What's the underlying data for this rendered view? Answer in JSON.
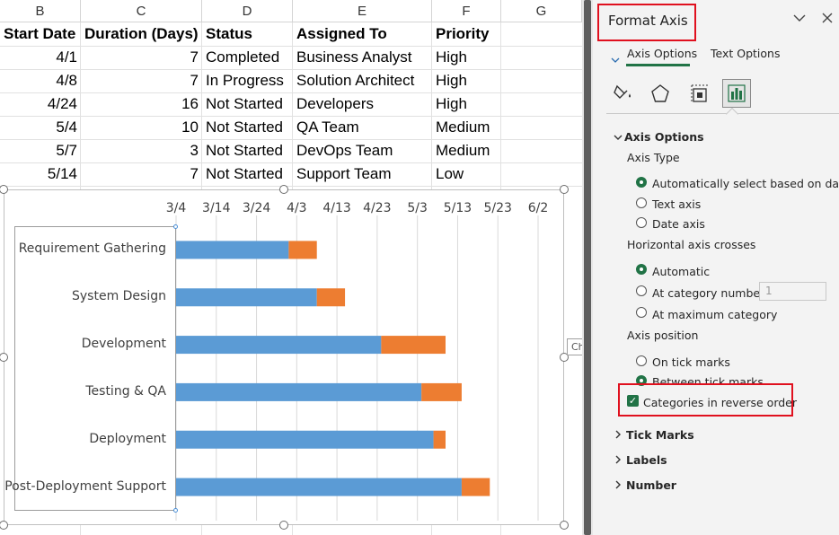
{
  "sheet": {
    "columns": [
      "B",
      "C",
      "D",
      "E",
      "F",
      "G"
    ],
    "headers": [
      "Start Date",
      "Duration (Days)",
      "Status",
      "Assigned To",
      "Priority"
    ],
    "rows": [
      {
        "start": "4/1",
        "duration": "7",
        "status": "Completed",
        "assigned": "Business Analyst",
        "priority": "High"
      },
      {
        "start": "4/8",
        "duration": "7",
        "status": "In Progress",
        "assigned": "Solution Architect",
        "priority": "High"
      },
      {
        "start": "4/24",
        "duration": "16",
        "status": "Not Started",
        "assigned": "Developers",
        "priority": "High"
      },
      {
        "start": "5/4",
        "duration": "10",
        "status": "Not Started",
        "assigned": "QA Team",
        "priority": "Medium"
      },
      {
        "start": "5/7",
        "duration": "3",
        "status": "Not Started",
        "assigned": "DevOps Team",
        "priority": "Medium"
      },
      {
        "start": "5/14",
        "duration": "7",
        "status": "Not Started",
        "assigned": "Support Team",
        "priority": "Low"
      }
    ]
  },
  "chart_data": {
    "type": "bar",
    "orientation": "horizontal",
    "stacked": true,
    "reverse_categories": true,
    "categories": [
      "Requirement Gathering",
      "System Design",
      "Development",
      "Testing & QA",
      "Deployment",
      "Post-Deployment Support"
    ],
    "x_tick_labels": [
      "3/4",
      "3/14",
      "3/24",
      "4/3",
      "4/13",
      "4/23",
      "5/3",
      "5/13",
      "5/23",
      "6/2"
    ],
    "x_range": [
      "3/4",
      "6/2"
    ],
    "grid": "vertical",
    "series": [
      {
        "values": [
          "4/1",
          "4/8",
          "4/24",
          "5/4",
          "5/7",
          "5/14"
        ],
        "color": "#5b9bd5"
      },
      {
        "values": [
          7,
          7,
          16,
          10,
          3,
          7
        ],
        "color": "#ed7d31"
      }
    ]
  },
  "chart": {
    "tooltip": "Chart Area"
  },
  "pane": {
    "title": "Format Axis",
    "tabs": [
      "Axis Options",
      "Text Options"
    ],
    "section_axis_options": "Axis Options",
    "axis_type": {
      "label": "Axis Type",
      "options": [
        "Automatically select based on data",
        "Text axis",
        "Date axis"
      ],
      "selected": 0
    },
    "h_axis_crosses": {
      "label": "Horizontal axis crosses",
      "options": [
        "Automatic",
        "At category number",
        "At maximum category"
      ],
      "selected": 0,
      "category_number": "1"
    },
    "axis_position": {
      "label": "Axis position",
      "options": [
        "On tick marks",
        "Between tick marks"
      ],
      "selected": 1
    },
    "reverse_order": {
      "label": "Categories in reverse order",
      "checked": true
    },
    "collapsed_sections": [
      "Tick Marks",
      "Labels",
      "Number"
    ],
    "colors": {
      "accent": "#217346",
      "highlight": "#e0101e"
    }
  }
}
